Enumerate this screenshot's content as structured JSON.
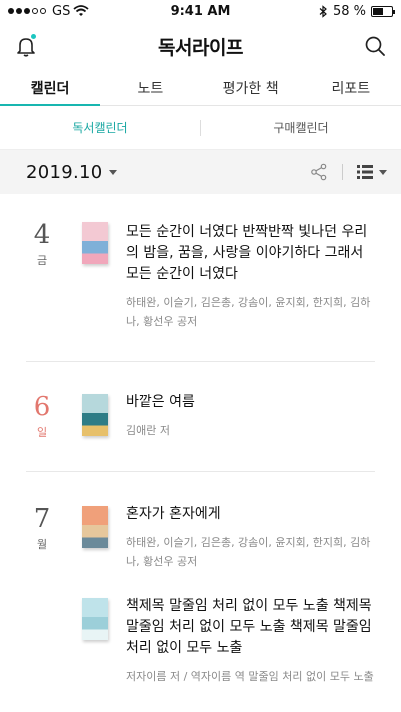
{
  "status_bar": {
    "carrier": "GS",
    "time": "9:41 AM",
    "battery": "58 %",
    "battery_level": 0.58
  },
  "header": {
    "title": "독서라이프",
    "left_icon": "bell-icon",
    "right_icon": "search-icon",
    "badge_color": "#1cc6c0"
  },
  "tabs": [
    {
      "label": "캘린더",
      "active": true
    },
    {
      "label": "노트",
      "active": false
    },
    {
      "label": "평가한 책",
      "active": false
    },
    {
      "label": "리포트",
      "active": false
    }
  ],
  "subtabs": [
    {
      "label": "독서캘린더",
      "active": true
    },
    {
      "label": "구매캘린더",
      "active": false
    }
  ],
  "toolbar": {
    "month": "2019.10",
    "share_icon": "share-icon",
    "view_icon": "list-view-icon"
  },
  "days": [
    {
      "date": "4",
      "weekday": "금",
      "sunday": false,
      "books": [
        {
          "title": "모든 순간이 너였다 반짝반짝 빛나던 우리의 밤을, 꿈을, 사랑을 이야기하다 그래서 모든 순간이 너였다",
          "authors": "하태완, 이슬기, 김은총, 강솜이, 윤지회, 한지희, 김하나, 황선우 공저",
          "cover_colors": [
            "#f3c9d3",
            "#7fb0d8",
            "#f1a7bb"
          ]
        }
      ]
    },
    {
      "date": "6",
      "weekday": "일",
      "sunday": true,
      "books": [
        {
          "title": "바깥은 여름",
          "authors": "김애란 저",
          "cover_colors": [
            "#b6d8dc",
            "#2e7c86",
            "#e7c06a"
          ]
        }
      ]
    },
    {
      "date": "7",
      "weekday": "월",
      "sunday": false,
      "books": [
        {
          "title": "혼자가 혼자에게",
          "authors": "하태완, 이슬기, 김은총, 강솜이, 윤지회, 한지희, 김하나, 황선우 공저",
          "cover_colors": [
            "#f0a07a",
            "#e6c79c",
            "#6b8a9a"
          ]
        },
        {
          "title": "책제목 말줄임 처리 없이 모두 노출  책제목 말줄임 처리 없이 모두 노출  책제목 말줄임 처리 없이 모두 노출",
          "authors": "저자이름 저 / 역자이름 역 말줄임 처리 없이 모두 노출",
          "cover_colors": [
            "#bfe3ea",
            "#9ccfd9",
            "#e8f4f5"
          ]
        }
      ]
    }
  ]
}
